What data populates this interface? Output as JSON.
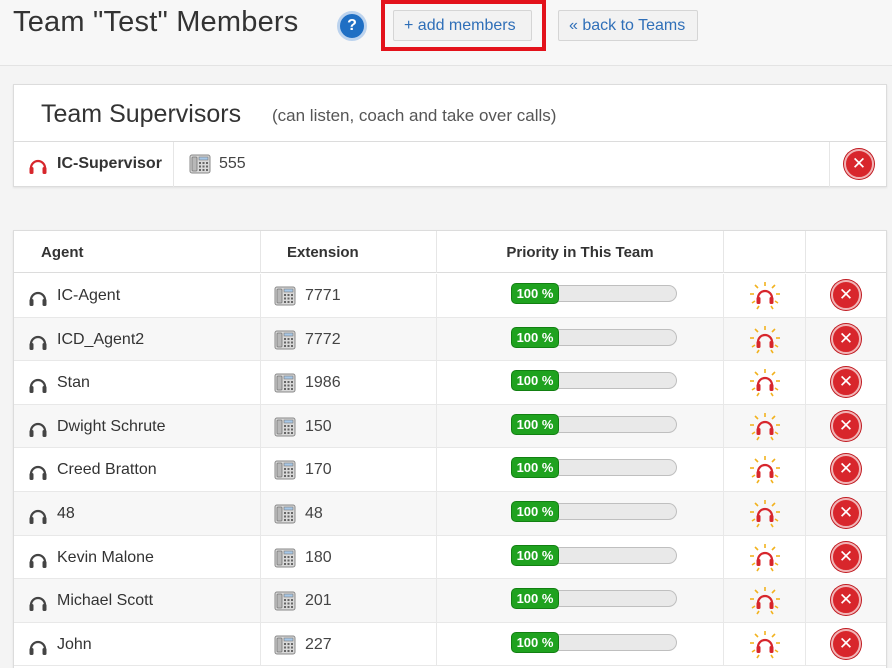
{
  "header": {
    "title": "Team \"Test\" Members",
    "help_icon": "question-circle-icon",
    "add_members_label": "+ add members",
    "back_label": "« back to Teams",
    "highlight_color": "#e3121b"
  },
  "supervisors": {
    "title": "Team Supervisors",
    "subtitle": "(can listen, coach and take over calls)",
    "rows": [
      {
        "name": "IC-Supervisor",
        "extension": "555"
      }
    ]
  },
  "agents": {
    "columns": {
      "agent": "Agent",
      "extension": "Extension",
      "priority": "Priority in This Team"
    },
    "rows": [
      {
        "name": "IC-Agent",
        "extension": "7771",
        "priority": "100 %"
      },
      {
        "name": "ICD_Agent2",
        "extension": "7772",
        "priority": "100 %"
      },
      {
        "name": "Stan",
        "extension": "1986",
        "priority": "100 %"
      },
      {
        "name": "Dwight Schrute",
        "extension": "150",
        "priority": "100 %"
      },
      {
        "name": "Creed Bratton",
        "extension": "170",
        "priority": "100 %"
      },
      {
        "name": "48",
        "extension": "48",
        "priority": "100 %"
      },
      {
        "name": "Kevin Malone",
        "extension": "180",
        "priority": "100 %"
      },
      {
        "name": "Michael Scott",
        "extension": "201",
        "priority": "100 %"
      },
      {
        "name": "John",
        "extension": "227",
        "priority": "100 %"
      }
    ]
  },
  "colors": {
    "link_blue": "#2f6fb8",
    "priority_green": "#1fa21f",
    "delete_red": "#d8262c"
  }
}
